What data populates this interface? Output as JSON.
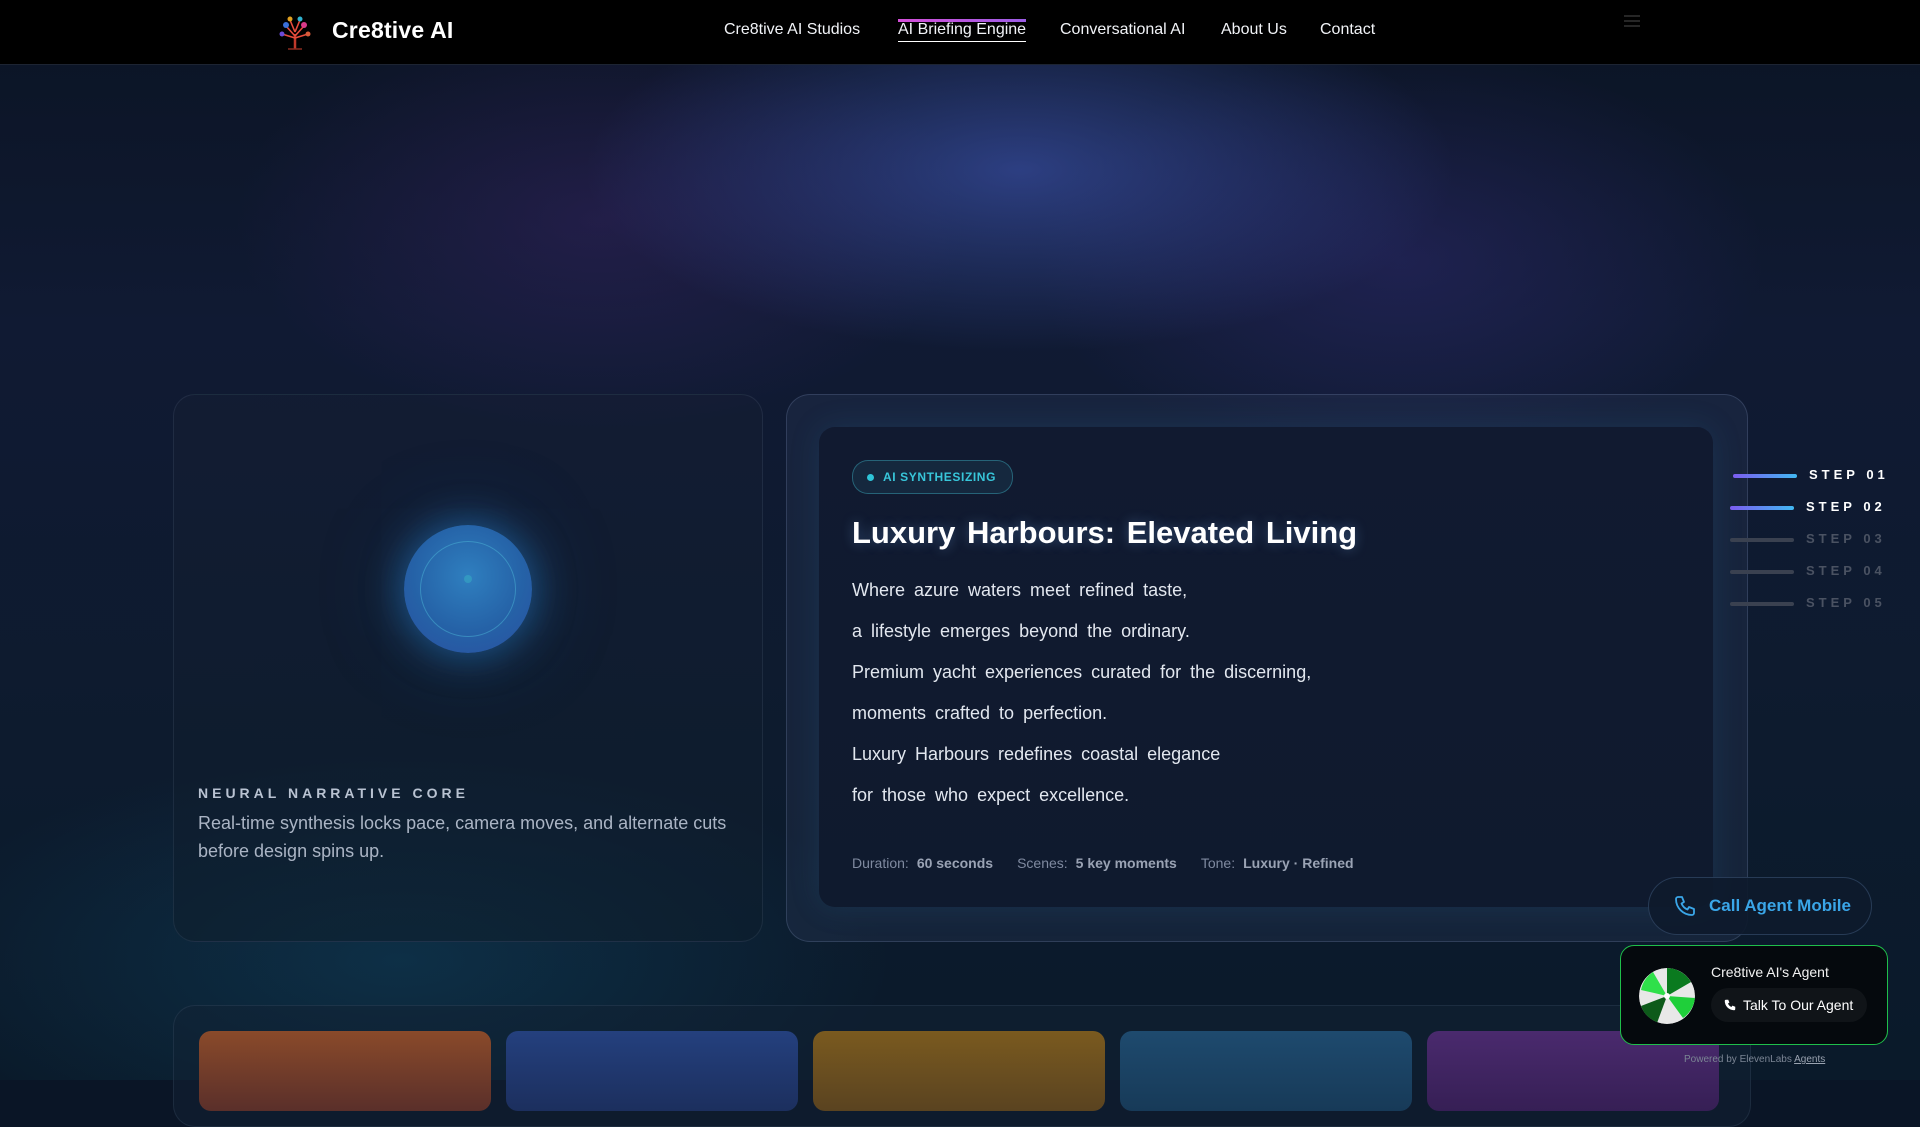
{
  "nav": {
    "brand": "Cre8tive AI",
    "links": [
      {
        "label": "Cre8tive AI Studios",
        "active": false
      },
      {
        "label": "AI Briefing Engine",
        "active": true
      },
      {
        "label": "Conversational AI",
        "active": false
      },
      {
        "label": "About Us",
        "active": false
      },
      {
        "label": "Contact",
        "active": false
      }
    ]
  },
  "core": {
    "label": "NEURAL NARRATIVE CORE",
    "description": "Real-time synthesis locks pace, camera moves, and alternate cuts before design spins up."
  },
  "card": {
    "badge": "AI SYNTHESIZING",
    "title": "Luxury Harbours: Elevated Living",
    "lines": [
      "Where azure waters meet refined taste,",
      "a lifestyle emerges beyond the ordinary.",
      "Premium yacht experiences curated for the discerning,",
      "moments crafted to perfection.",
      "Luxury Harbours redefines coastal elegance",
      "for those who expect excellence."
    ],
    "meta": {
      "duration_label": "Duration:",
      "duration_value": "60 seconds",
      "scenes_label": "Scenes:",
      "scenes_value": "5 key moments",
      "tone_label": "Tone:",
      "tone_value": "Luxury · Refined"
    }
  },
  "steps": [
    {
      "label": "STEP 01",
      "active": true
    },
    {
      "label": "STEP 02",
      "active": true
    },
    {
      "label": "STEP 03",
      "active": false
    },
    {
      "label": "STEP 04",
      "active": false
    },
    {
      "label": "STEP 05",
      "active": false
    }
  ],
  "call_button": {
    "label": "Call Agent Mobile"
  },
  "agent": {
    "name": "Cre8tive AI's Agent",
    "button": "Talk To Our Agent",
    "powered_prefix": "Powered by ElevenLabs",
    "powered_link": "Agents"
  },
  "colors": {
    "accent_cyan": "#38c6da",
    "call_blue": "#3aa6e8",
    "agent_green": "#1fbf4a",
    "step_gradient_start": "#7c5cf0",
    "step_gradient_end": "#41b8f2"
  },
  "icons": {
    "logo": "tree-logo-icon",
    "call": "phone-icon",
    "agent_button": "phone-icon",
    "agent_avatar": "green-orb-avatar"
  },
  "tiles": [
    {
      "color": "#8a4a2a"
    },
    {
      "color": "#233d7a"
    },
    {
      "color": "#7a5a1f"
    },
    {
      "color": "#1e4a6e"
    },
    {
      "color": "#4a2a6e"
    }
  ]
}
